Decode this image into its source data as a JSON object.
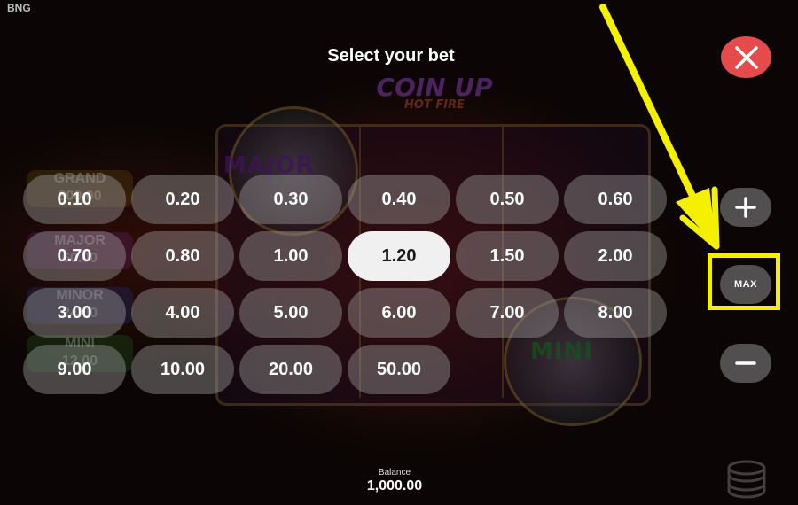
{
  "brand": "BNG",
  "background": {
    "logo_line1": "COIN UP",
    "logo_line2": "HOT FIRE",
    "jackpots": [
      {
        "name": "GRAND",
        "amount": "800.00"
      },
      {
        "name": "MAJOR",
        "amount": "60.00"
      },
      {
        "name": "MINOR",
        "amount": "24.00"
      },
      {
        "name": "MINI",
        "amount": "12.00"
      }
    ],
    "coin_labels": {
      "major": "MAJOR",
      "mini": "MINI"
    }
  },
  "dialog": {
    "title": "Select your bet",
    "bets": [
      "0.10",
      "0.20",
      "0.30",
      "0.40",
      "0.50",
      "0.60",
      "0.70",
      "0.80",
      "1.00",
      "1.20",
      "1.50",
      "2.00",
      "3.00",
      "4.00",
      "5.00",
      "6.00",
      "7.00",
      "8.00",
      "9.00",
      "10.00",
      "20.00",
      "50.00"
    ],
    "selected_bet": "1.20",
    "max_label": "MAX"
  },
  "balance": {
    "label": "Balance",
    "value": "1,000.00"
  },
  "icons": {
    "close": "close-icon",
    "plus": "plus-icon",
    "minus": "minus-icon",
    "coins": "coin-stack-icon"
  },
  "colors": {
    "close_button": "#e64b4b",
    "highlight": "#f5f000",
    "selected_bet_bg": "#f0f0f0"
  }
}
